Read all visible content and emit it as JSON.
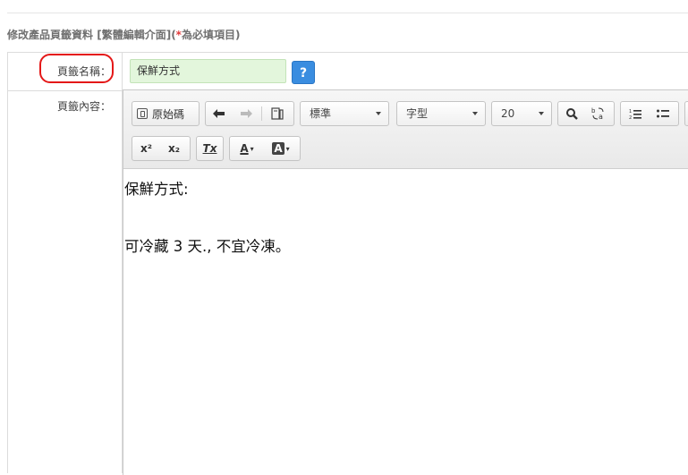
{
  "page": {
    "section_title_main": "修改產品頁籤資料",
    "section_title_mode": "[繁體編輯介面]",
    "section_title_paren_open": "(",
    "section_title_required_mark": "*",
    "section_title_required_text": "為必填項目)"
  },
  "form": {
    "name_label": "頁籤名稱：",
    "name_value": "保鮮方式",
    "help_label": "?",
    "content_label": "頁籤內容："
  },
  "editor": {
    "toolbar": {
      "source_label": "原始碼",
      "format_value": "標準",
      "font_value": "字型",
      "size_value": "20",
      "superscript_label": "x²",
      "subscript_label": "x₂",
      "remove_format_label": "Tx",
      "text_color_label": "A",
      "bg_color_label": "A"
    },
    "content": {
      "line1": "保鮮方式:",
      "line2": "可冷藏 3 天., 不宜冷凍。"
    }
  },
  "colors": {
    "highlight_ring": "#e41818",
    "help_button": "#3a8de0",
    "name_input_bg": "#e3f6dc",
    "required_mark": "#e23b3b"
  },
  "icons": [
    "undo-icon",
    "redo-icon",
    "paste-icon",
    "find-icon",
    "replace-icon",
    "numbered-list-icon",
    "bulleted-list-icon",
    "caret-down-icon"
  ]
}
